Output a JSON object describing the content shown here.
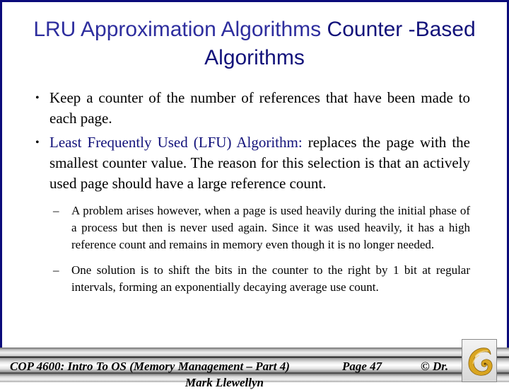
{
  "slide": {
    "title_part1": "LRU Approximation Algorithms",
    "title_part2": "Counter -Based Algorithms",
    "bullets": [
      {
        "marker": "•",
        "lead": "",
        "text": "Keep a counter of the number of references that have been made to each page."
      },
      {
        "marker": "•",
        "lead": "Least Frequently Used (LFU) Algorithm:",
        "text": " replaces the page with the smallest counter value.  The reason for this selection is that an actively used page should have a large reference count."
      }
    ],
    "sub_bullets": [
      {
        "marker": "–",
        "text": "A problem arises however, when a page is used heavily during the initial phase of a process but then is never used again.  Since it was used heavily, it has a high reference count and remains in memory even though it is no longer needed."
      },
      {
        "marker": "–",
        "text": "One solution is to shift the bits in the counter to the right by 1 bit at regular intervals, forming an exponentially decaying average use count."
      }
    ]
  },
  "footer": {
    "course": "COP 4600: Intro To OS  (Memory Management – Part 4)",
    "page": "Page 47",
    "copyright": "© Dr.",
    "author": "Mark Llewellyn",
    "logo_icon": "pegasus-logo-icon"
  },
  "colors": {
    "frame": "#0b0b7a",
    "title_light": "#2e2e9e",
    "title_dark": "#12127a",
    "logo_gold": "#d9a520"
  }
}
